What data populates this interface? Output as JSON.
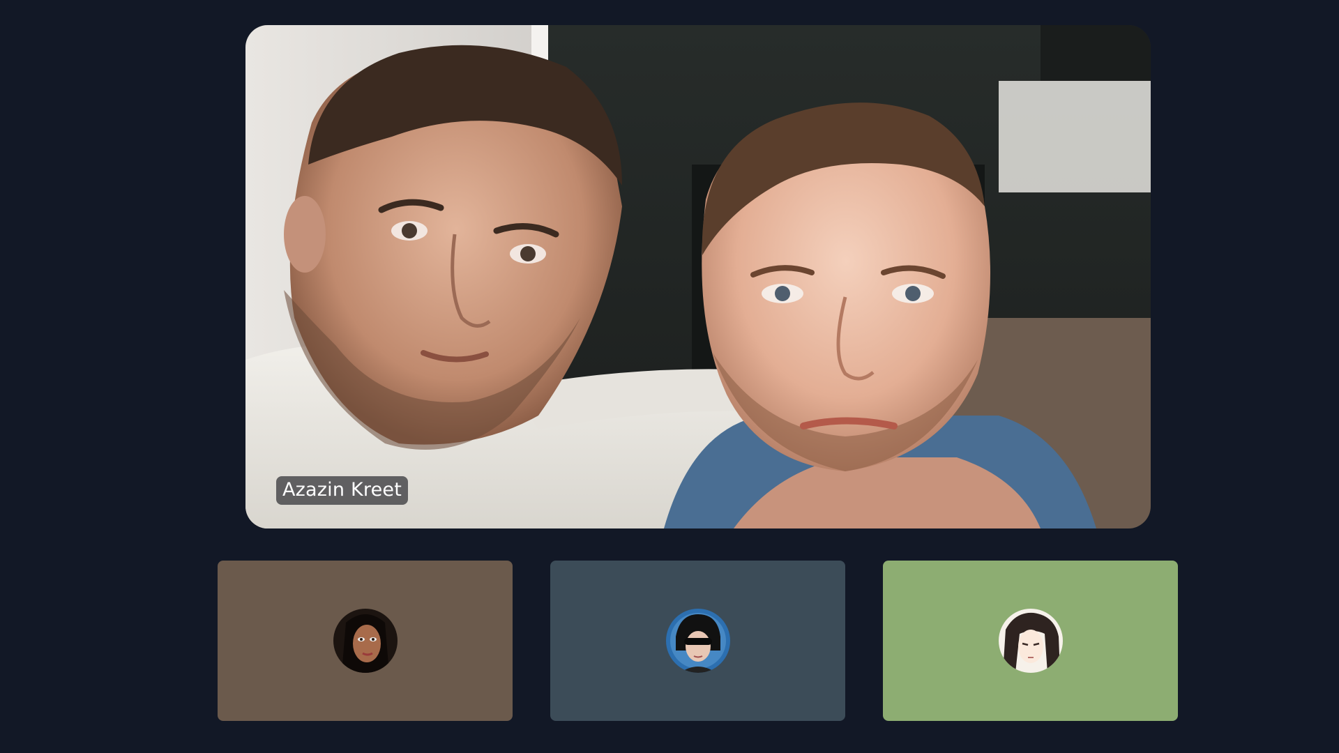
{
  "call": {
    "active_speaker": {
      "name": "Azazin Kreet",
      "video": "video-feed"
    },
    "participants": [
      {
        "avatar": "avatar-icon",
        "tile_color": "#6b5a4c"
      },
      {
        "avatar": "avatar-icon",
        "tile_color": "#3c4c58"
      },
      {
        "avatar": "avatar-icon",
        "tile_color": "#8dad72"
      }
    ]
  },
  "colors": {
    "background": "#121826",
    "name_tag_bg": "#3c3c40",
    "name_tag_text": "#ffffff"
  }
}
